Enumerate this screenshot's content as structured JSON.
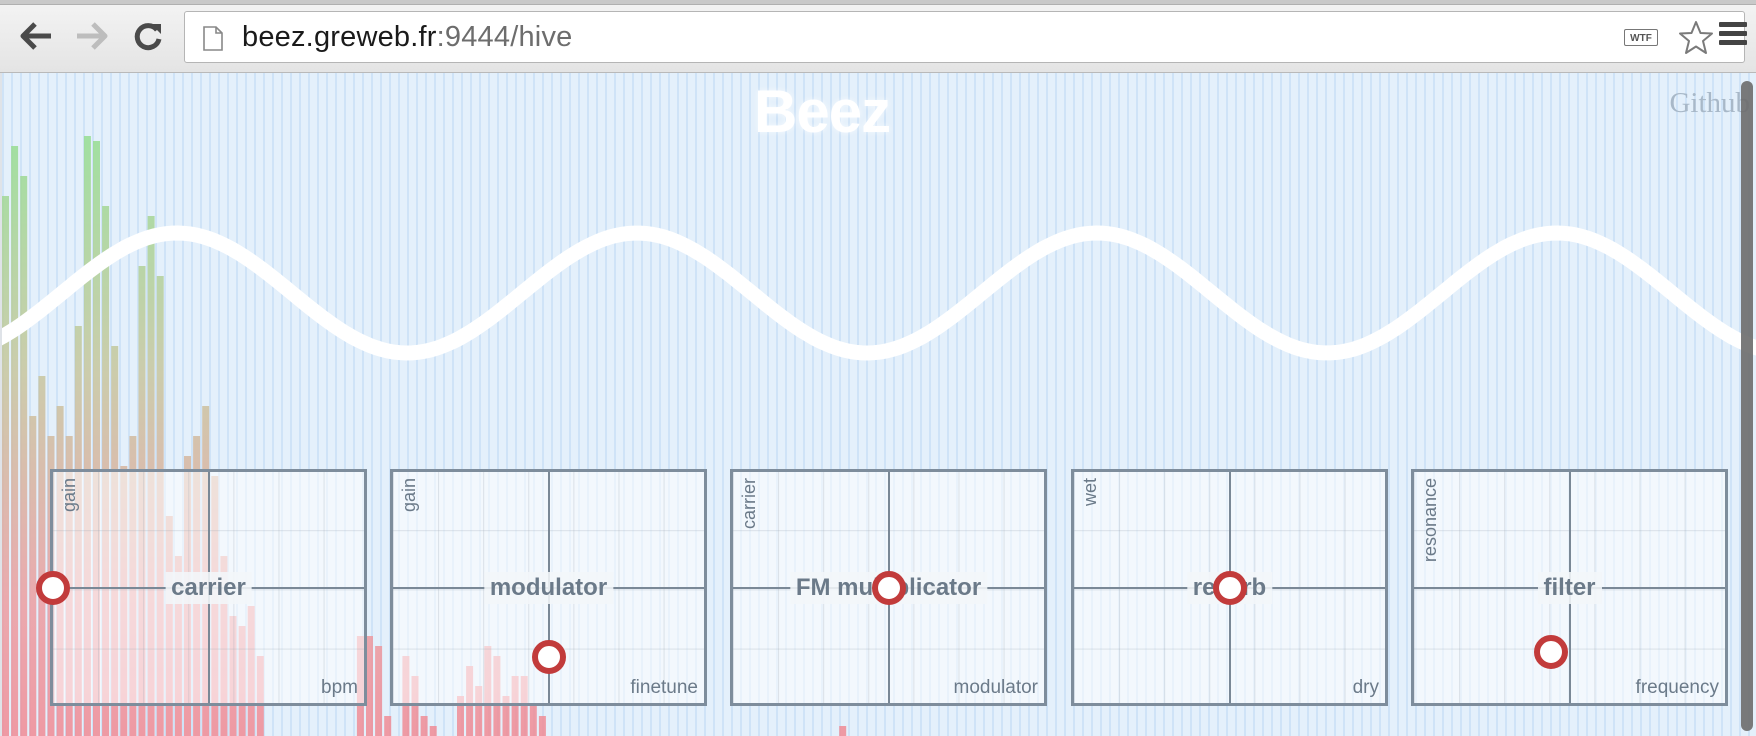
{
  "browser": {
    "url_host": "beez.greweb.fr",
    "url_rest": ":9444/hive",
    "wtf_badge": "WTF",
    "icons": [
      "back-arrow-icon",
      "forward-arrow-icon",
      "reload-icon",
      "page-icon",
      "star-icon",
      "menu-icon"
    ]
  },
  "app": {
    "title": "Beez",
    "github_label": "Github"
  },
  "pads": [
    {
      "name": "carrier",
      "ylabel": "gain",
      "xlabel": "bpm",
      "knob_x": 0.0,
      "knob_y": 0.5
    },
    {
      "name": "modulator",
      "ylabel": "gain",
      "xlabel": "finetune",
      "knob_x": 0.5,
      "knob_y": 0.8
    },
    {
      "name": "FM multiplicator",
      "ylabel": "carrier",
      "xlabel": "modulator",
      "knob_x": 0.5,
      "knob_y": 0.5
    },
    {
      "name": "reverb",
      "ylabel": "wet",
      "xlabel": "dry",
      "knob_x": 0.5,
      "knob_y": 0.5
    },
    {
      "name": "filter",
      "ylabel": "resonance",
      "xlabel": "frequency",
      "knob_x": 0.44,
      "knob_y": 0.78
    }
  ],
  "colors": {
    "knob": "#c23b3b",
    "pad_border": "#7e8d9c",
    "background": "#e2effb",
    "bars_top": "#8fe08f",
    "bars_bottom": "#f08a94"
  }
}
